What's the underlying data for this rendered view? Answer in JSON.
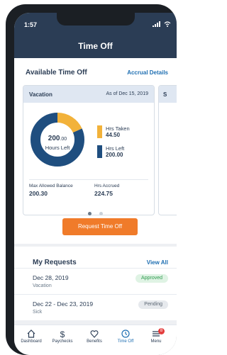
{
  "status": {
    "time": "1:57"
  },
  "nav": {
    "title": "Time Off"
  },
  "available": {
    "title": "Available Time Off",
    "link": "Accrual Details",
    "card": {
      "name": "Vacation",
      "as_of": "As of Dec 15, 2019",
      "donut": {
        "center_value": "200",
        "center_decimal": ".00",
        "center_label": "Hours Left"
      },
      "legend": [
        {
          "label": "Hrs Taken",
          "value": "44.50",
          "color": "#f2b23a"
        },
        {
          "label": "Hrs Left",
          "value": "200.00",
          "color": "#1f4e7f"
        }
      ],
      "stats": [
        {
          "label": "Max Allowed Balance",
          "value": "200.30"
        },
        {
          "label": "Hrs Accrued",
          "value": "224.75"
        }
      ]
    },
    "peek_card_label": "S",
    "button": "Request Time Off"
  },
  "chart_data": {
    "type": "pie",
    "categories": [
      "Hrs Taken",
      "Hrs Left"
    ],
    "values": [
      44.5,
      200.0
    ]
  },
  "requests": {
    "title": "My Requests",
    "link": "View All",
    "items": [
      {
        "date": "Dec 28, 2019",
        "type": "Vacation",
        "status": "Approved",
        "status_color": "#2e9b4e"
      },
      {
        "date": "Dec 22 - Dec 23, 2019",
        "type": "Sick",
        "status": "Pending",
        "status_color": "#5b6673"
      }
    ]
  },
  "tabs": [
    {
      "label": "Dashboard",
      "icon": "home-icon",
      "active": false
    },
    {
      "label": "Paychecks",
      "icon": "dollar-icon",
      "active": false
    },
    {
      "label": "Benefits",
      "icon": "heart-icon",
      "active": false
    },
    {
      "label": "Time Off",
      "icon": "clock-icon",
      "active": true
    },
    {
      "label": "Menu",
      "icon": "menu-icon",
      "active": false,
      "badge": "8"
    }
  ],
  "colors": {
    "navy": "#2b3d55",
    "accent": "#f07b2a",
    "link": "#1f6fb2"
  }
}
